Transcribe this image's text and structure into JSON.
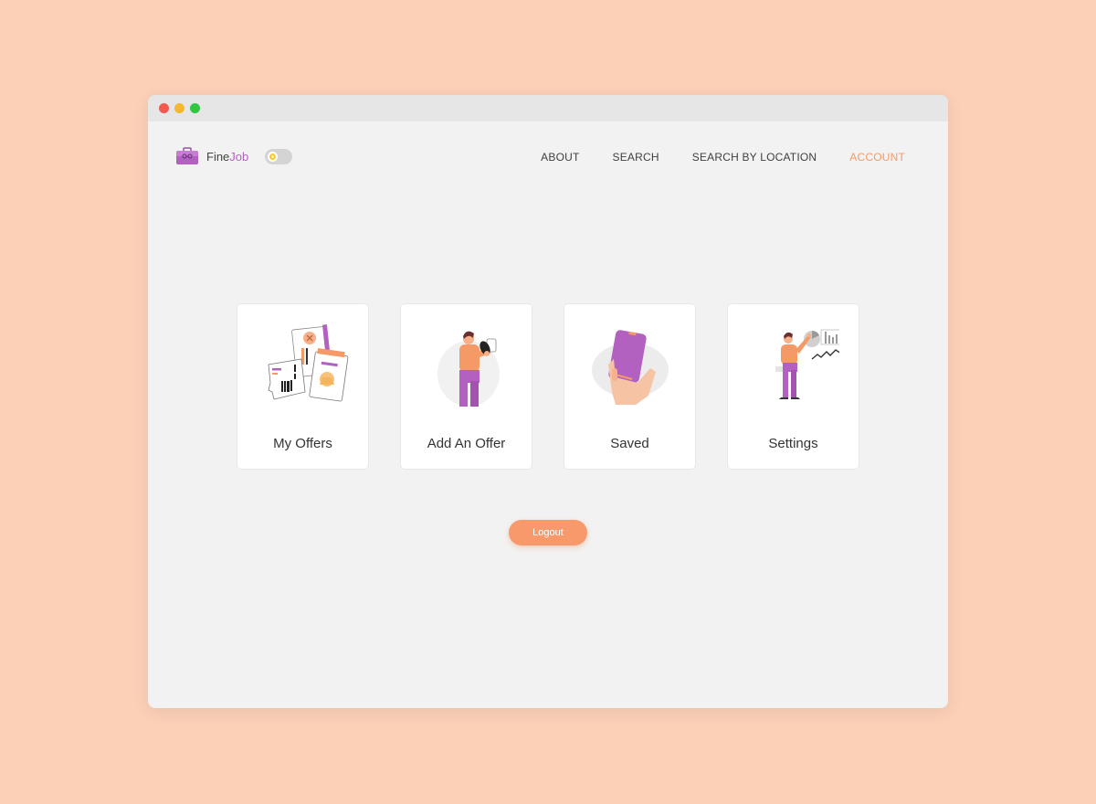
{
  "window": {
    "controls": [
      "close",
      "minimize",
      "maximize"
    ]
  },
  "brand": {
    "name_part1": "Fine",
    "name_part2": "Job",
    "icon": "briefcase-icon",
    "accent": "#b361c0"
  },
  "theme_toggle": {
    "icon": "sun-icon",
    "state": "light"
  },
  "nav": {
    "items": [
      {
        "label": "ABOUT",
        "active": false
      },
      {
        "label": "SEARCH",
        "active": false
      },
      {
        "label": "SEARCH BY LOCATION",
        "active": false
      },
      {
        "label": "ACCOUNT",
        "active": true
      }
    ],
    "active_color": "#f59a66"
  },
  "cards": [
    {
      "label": "My Offers",
      "illustration": "offers-documents-illustration"
    },
    {
      "label": "Add An Offer",
      "illustration": "person-adding-offer-illustration"
    },
    {
      "label": "Saved",
      "illustration": "phone-in-hand-illustration"
    },
    {
      "label": "Settings",
      "illustration": "person-with-charts-illustration"
    }
  ],
  "logout": {
    "label": "Logout",
    "color": "#f7996a"
  },
  "colors": {
    "background": "#fbd0b7",
    "window": "#f2f2f2",
    "purple": "#b361c0",
    "orange": "#f59a66"
  }
}
